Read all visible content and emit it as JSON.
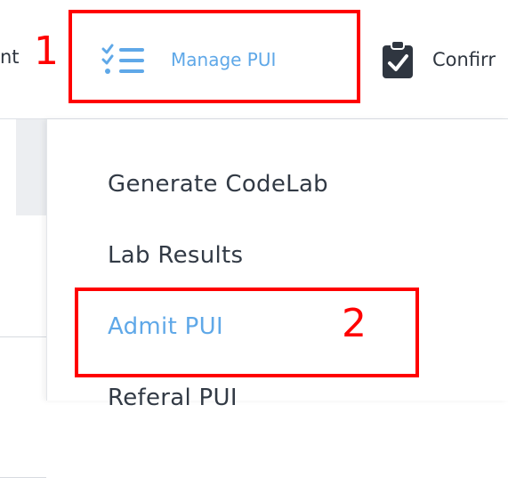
{
  "nav": {
    "prev_tail": "nt",
    "manage_label": "Manage PUI",
    "confirm_label": "Confirr"
  },
  "menu": {
    "items": [
      {
        "label": "Generate CodeLab"
      },
      {
        "label": "Lab Results"
      },
      {
        "label": "Admit PUI"
      },
      {
        "label": "Referal PUI"
      }
    ]
  },
  "annotations": {
    "step1": "1",
    "step2": "2"
  },
  "icons": {
    "manage": "checklist-icon",
    "confirm": "clipboard-check-icon"
  },
  "colors": {
    "accent": "#5fa8e8",
    "highlight": "#ff0000",
    "text": "#323a45"
  }
}
